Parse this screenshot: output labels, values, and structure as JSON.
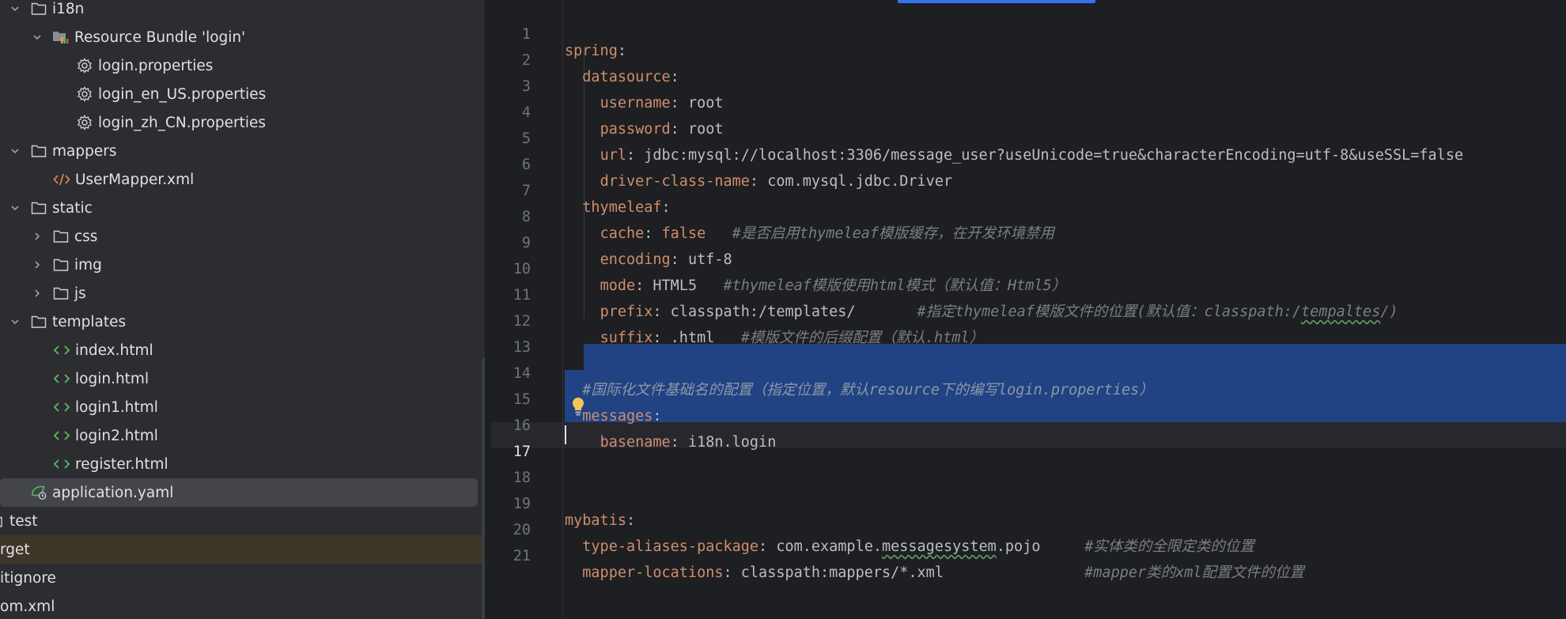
{
  "project_tree": {
    "items": [
      {
        "label": "i18n",
        "type": "folder",
        "expanded": true
      },
      {
        "label": "Resource Bundle 'login'",
        "type": "bundle",
        "expanded": true
      },
      {
        "label": "login.properties",
        "type": "properties"
      },
      {
        "label": "login_en_US.properties",
        "type": "properties"
      },
      {
        "label": "login_zh_CN.properties",
        "type": "properties"
      },
      {
        "label": "mappers",
        "type": "folder",
        "expanded": true
      },
      {
        "label": "UserMapper.xml",
        "type": "xml"
      },
      {
        "label": "static",
        "type": "folder",
        "expanded": true
      },
      {
        "label": "css",
        "type": "folder",
        "expanded": false
      },
      {
        "label": "img",
        "type": "folder",
        "expanded": false
      },
      {
        "label": "js",
        "type": "folder",
        "expanded": false
      },
      {
        "label": "templates",
        "type": "folder",
        "expanded": true
      },
      {
        "label": "index.html",
        "type": "html"
      },
      {
        "label": "login.html",
        "type": "html"
      },
      {
        "label": "login1.html",
        "type": "html"
      },
      {
        "label": "login2.html",
        "type": "html"
      },
      {
        "label": "register.html",
        "type": "html"
      },
      {
        "label": "application.yaml",
        "type": "yaml",
        "selected": true
      },
      {
        "label": "test",
        "type": "folder-partial"
      },
      {
        "label": "rget",
        "type": "excluded"
      },
      {
        "label": "itignore",
        "type": "file"
      },
      {
        "label": "om.xml",
        "type": "file"
      }
    ]
  },
  "editor": {
    "line_numbers": [
      "1",
      "2",
      "3",
      "4",
      "5",
      "6",
      "7",
      "8",
      "9",
      "10",
      "11",
      "12",
      "13",
      "14",
      "15",
      "16",
      "17",
      "18",
      "19",
      "20",
      "21"
    ],
    "current_line": "17",
    "lines": {
      "l1_key": "spring",
      "l2_key": "datasource",
      "l3_key": "username",
      "l3_val": " root",
      "l4_key": "password",
      "l4_val": " root",
      "l5_key": "url",
      "l5_val": " jdbc:mysql://localhost:3306/message_user?useUnicode=true&characterEncoding=utf-8&useSSL=false",
      "l6_key": "driver-class-name",
      "l6_val": " com.mysql.jdbc.Driver",
      "l7_key": "thymeleaf",
      "l8_key": "cache",
      "l8_val": "false",
      "l8_cmt": "#是否启用thymeleaf模版缓存，在开发环境禁用",
      "l9_key": "encoding",
      "l9_val": " utf-8",
      "l10_key": "mode",
      "l10_val": " HTML5",
      "l10_cmt": "#thymeleaf模版使用html模式（默认值：Html5）",
      "l11_key": "prefix",
      "l11_val": " classpath:/templates/",
      "l11_cmt_a": "#指定thymeleaf模版文件的位置(默认值：classpath:/",
      "l11_cmt_b": "tempaltes",
      "l11_cmt_c": "/)",
      "l12_key": "suffix",
      "l12_val": " .html",
      "l12_cmt": "#模版文件的后缀配置（默认.html）",
      "l14_cmt": "#国际化文件基础名的配置（指定位置，默认resource下的编写login.properties）",
      "l15_key": "messages",
      "l16_key": "basename",
      "l16_val": " i18n.login",
      "l19_key": "mybatis",
      "l20_key": "type-aliases-package",
      "l20_val_a": " com.example.",
      "l20_val_b": "messagesystem",
      "l20_val_c": ".pojo",
      "l20_cmt": "#实体类的全限定类的位置",
      "l21_key": "mapper-locations",
      "l21_val": " classpath:mappers/*.xml",
      "l21_cmt": "#mapper类的xml配置文件的位置"
    }
  },
  "colors": {
    "tree_bg": "#2b2d30",
    "editor_bg": "#1e1f22",
    "selection": "#214283",
    "key": "#cf8e6d",
    "comment": "#7a7e85",
    "accent": "#3574f0"
  }
}
